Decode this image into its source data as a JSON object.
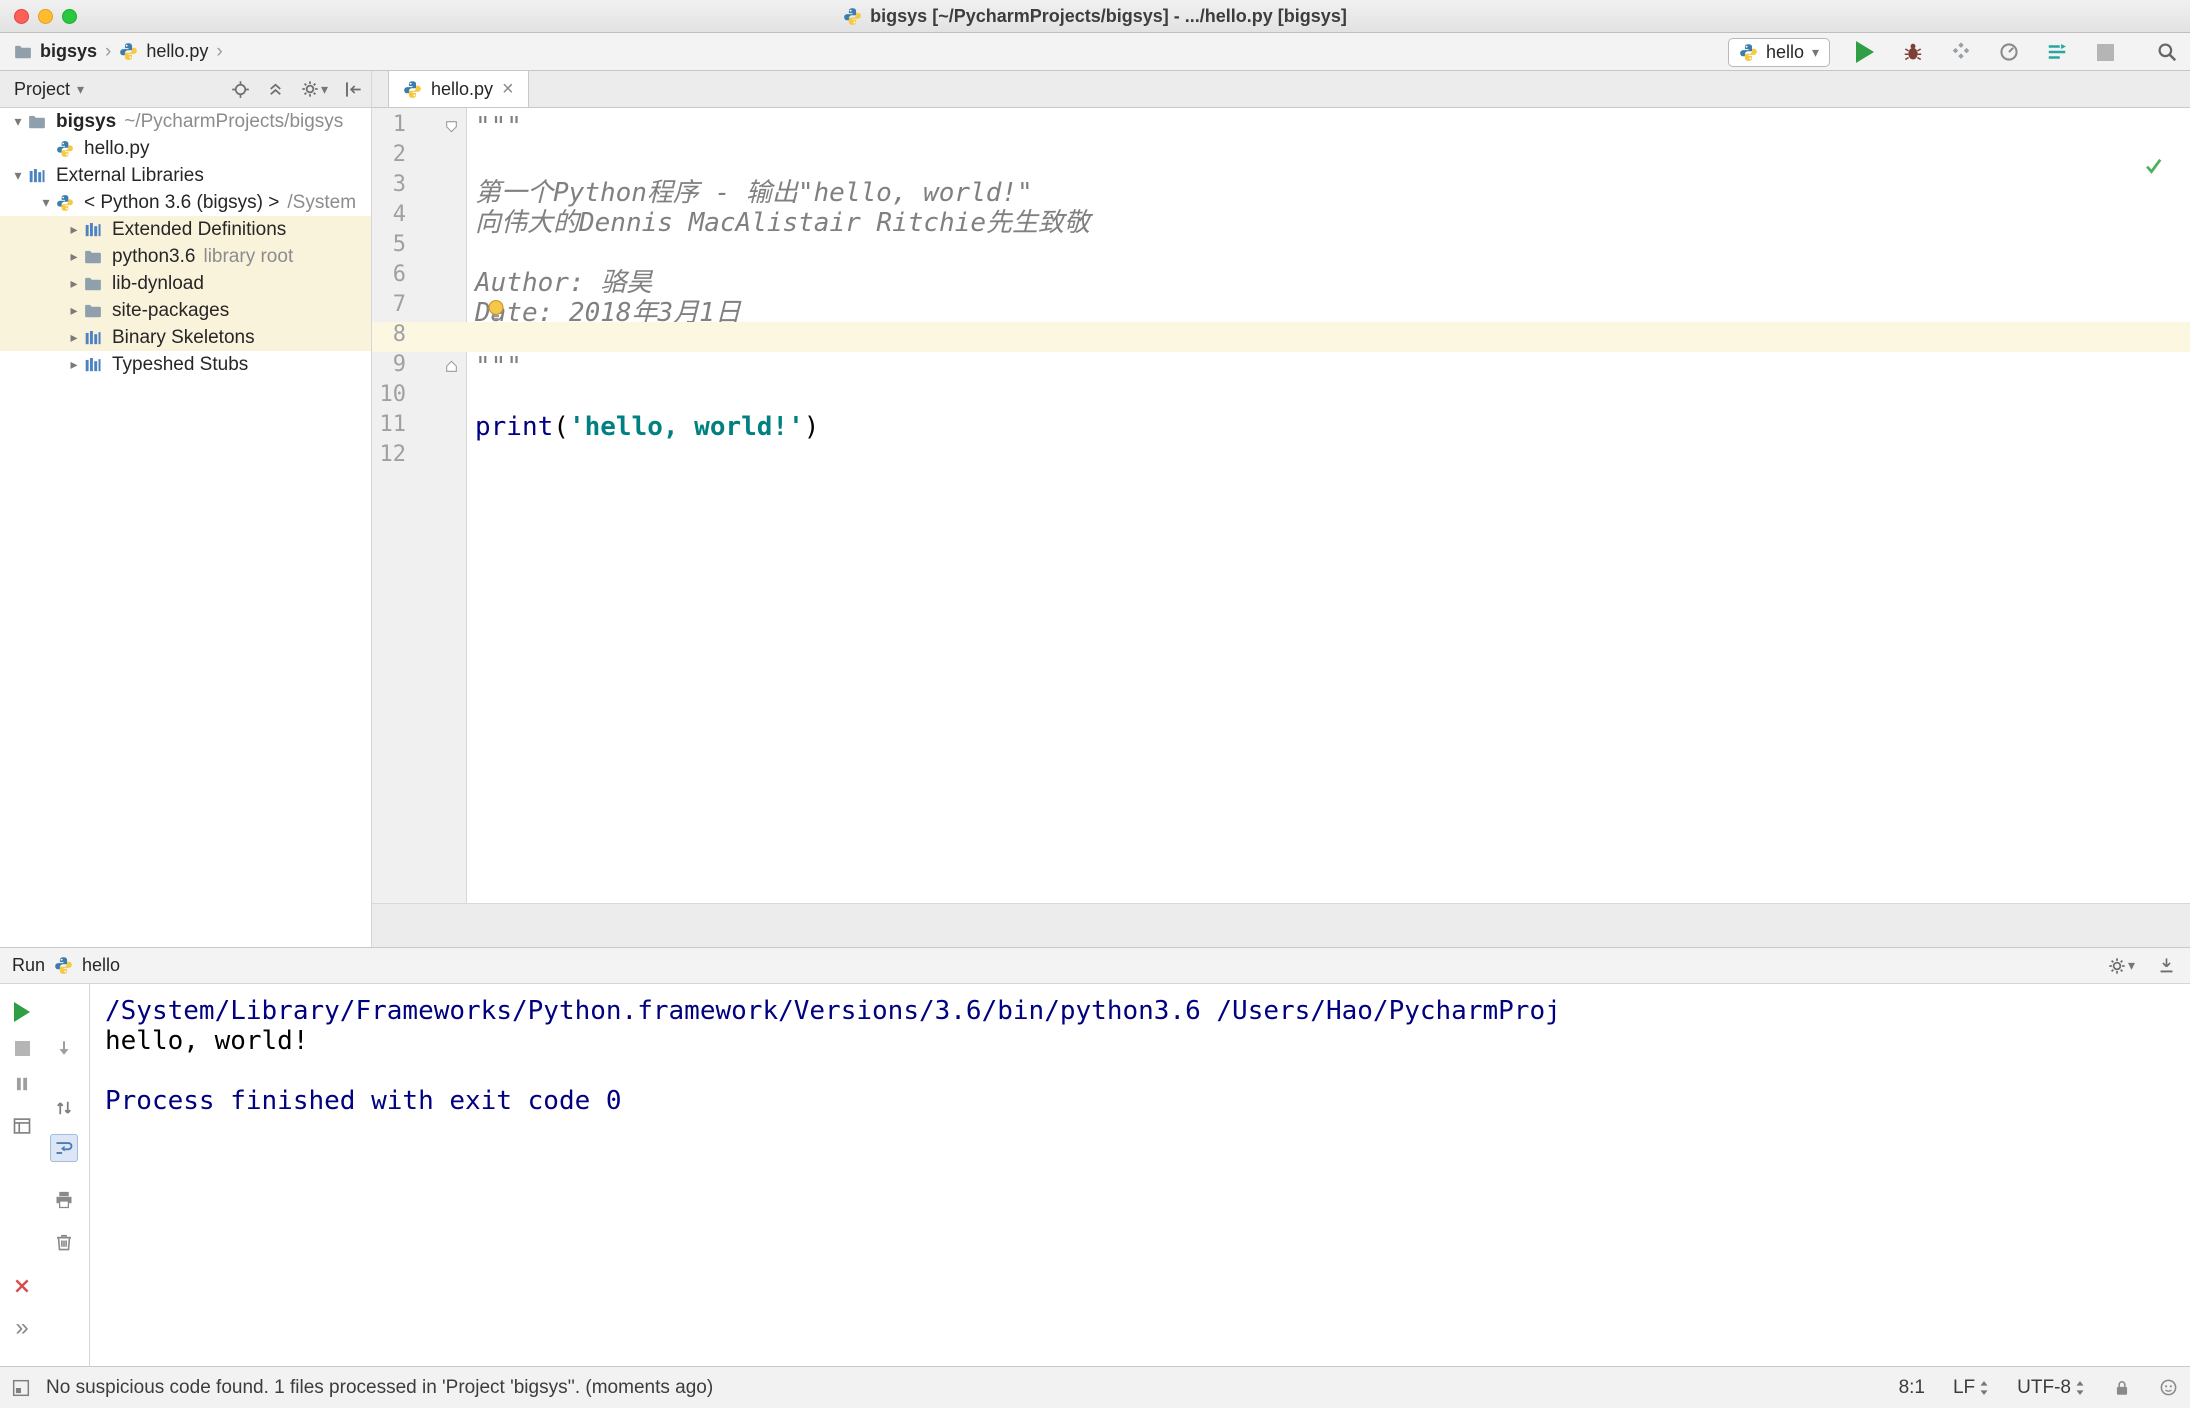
{
  "icons": {
    "chevron": "›",
    "dropdown": "▾",
    "tab_close": "×",
    "chevrons_more": "»",
    "arrow_collapsed": "▸",
    "arrow_expanded": "▾"
  },
  "colors": {
    "keyword": "#000080",
    "string": "#008080",
    "docstring": "#808080",
    "console_system": "#000080",
    "tree_highlight": "#faf3dc",
    "current_line": "#fbf7e1",
    "run_green": "#2f9e44"
  },
  "titlebar": {
    "title": "bigsys [~/PycharmProjects/bigsys] - .../hello.py [bigsys]"
  },
  "navbar": {
    "breadcrumbs": [
      {
        "label": "bigsys",
        "icon": "folder"
      },
      {
        "label": "hello.py",
        "icon": "python"
      }
    ],
    "run_config": {
      "label": "hello"
    }
  },
  "project_panel": {
    "title": "Project",
    "tree": [
      {
        "label": "bigsys",
        "sub": "~/PycharmProjects/bigsys",
        "icon": "folder",
        "arrow": "down",
        "level": 0,
        "bold": true
      },
      {
        "label": "hello.py",
        "icon": "python",
        "arrow": "none",
        "level": 1
      },
      {
        "label": "External Libraries",
        "icon": "library",
        "arrow": "down",
        "level": 0
      },
      {
        "label": "< Python 3.6 (bigsys) >",
        "sub": "/System",
        "icon": "python",
        "arrow": "down",
        "level": 1
      },
      {
        "label": "Extended Definitions",
        "icon": "library",
        "arrow": "right",
        "level": 2,
        "highlight": true
      },
      {
        "label": "python3.6",
        "sub": "library root",
        "icon": "folder",
        "arrow": "right",
        "level": 2,
        "highlight": true
      },
      {
        "label": "lib-dynload",
        "icon": "folder",
        "arrow": "right",
        "level": 2,
        "highlight": true
      },
      {
        "label": "site-packages",
        "icon": "folder",
        "arrow": "right",
        "level": 2,
        "highlight": true
      },
      {
        "label": "Binary Skeletons",
        "icon": "library",
        "arrow": "right",
        "level": 2,
        "highlight": true
      },
      {
        "label": "Typeshed Stubs",
        "icon": "library",
        "arrow": "right",
        "level": 2
      }
    ]
  },
  "editor": {
    "tab": {
      "label": "hello.py"
    },
    "current_line": 8,
    "lines": [
      {
        "n": "1",
        "fold": "top",
        "segs": [
          {
            "t": "\"\"\"",
            "c": "doc"
          }
        ]
      },
      {
        "n": "2",
        "segs": []
      },
      {
        "n": "3",
        "segs": [
          {
            "t": "第一个Python程序 - 输出\"hello, world!\"",
            "c": "doc"
          }
        ]
      },
      {
        "n": "4",
        "segs": [
          {
            "t": "向伟大的Dennis MacAlistair Ritchie先生致敬",
            "c": "doc"
          }
        ]
      },
      {
        "n": "5",
        "segs": []
      },
      {
        "n": "6",
        "segs": [
          {
            "t": "Author: 骆昊",
            "c": "doc"
          }
        ]
      },
      {
        "n": "7",
        "segs": [
          {
            "t": "Date: 2018年3月1日",
            "c": "doc"
          }
        ]
      },
      {
        "n": "8",
        "cur": true,
        "segs": []
      },
      {
        "n": "9",
        "fold": "bottom",
        "segs": [
          {
            "t": "\"\"\"",
            "c": "doc"
          }
        ]
      },
      {
        "n": "10",
        "segs": []
      },
      {
        "n": "11",
        "segs": [
          {
            "t": "print",
            "c": "kw"
          },
          {
            "t": "(",
            "c": "plain"
          },
          {
            "t": "'hello, world!'",
            "c": "str"
          },
          {
            "t": ")",
            "c": "plain"
          }
        ]
      },
      {
        "n": "12",
        "segs": []
      }
    ]
  },
  "run_panel": {
    "title": "Run",
    "config": "hello",
    "console": [
      {
        "text": "/System/Library/Frameworks/Python.framework/Versions/3.6/bin/python3.6 /Users/Hao/PycharmProj",
        "style": "system"
      },
      {
        "text": "hello, world!",
        "style": "stdout"
      },
      {
        "text": "",
        "style": "stdout"
      },
      {
        "text": "Process finished with exit code 0",
        "style": "system"
      }
    ]
  },
  "statusbar": {
    "message": "No suspicious code found. 1 files processed in 'Project 'bigsys''. (moments ago)",
    "caret_position": "8:1",
    "line_separator": "LF",
    "encoding": "UTF-8"
  }
}
